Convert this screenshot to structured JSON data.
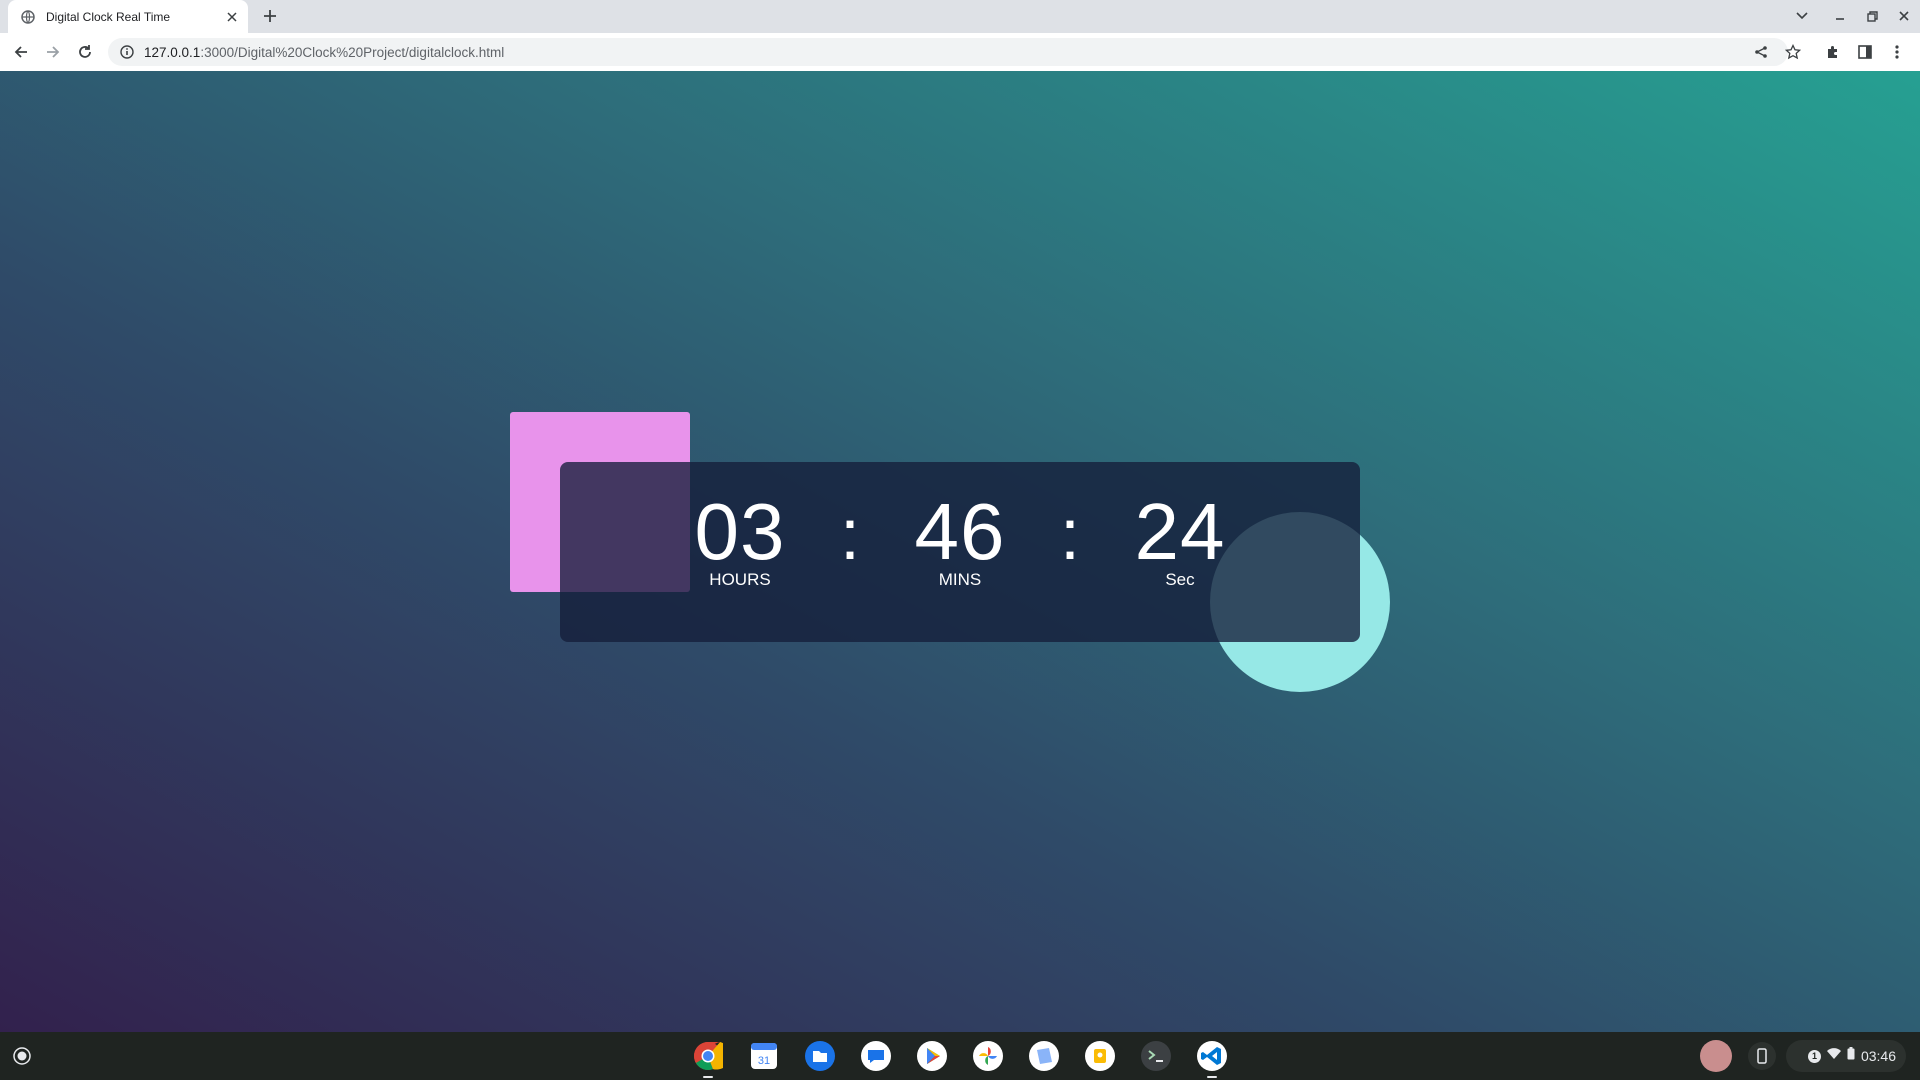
{
  "browser": {
    "tab_title": "Digital Clock Real Time",
    "url_host": "127.0.0.1",
    "url_rest": ":3000/Digital%20Clock%20Project/digitalclock.html"
  },
  "clock": {
    "hours": "03",
    "minutes": "46",
    "seconds": "24",
    "hours_label": "HOURS",
    "minutes_label": "MINS",
    "seconds_label": "Sec",
    "separator": ":"
  },
  "colors": {
    "square": "#e893eb",
    "circle": "#96e8e6",
    "card": "#141e3a"
  },
  "shelf": {
    "apps": [
      "chrome-icon",
      "calendar-icon",
      "files-icon",
      "messages-icon",
      "play-store-icon",
      "photos-icon",
      "gallery-icon",
      "keep-icon",
      "terminal-icon",
      "vscode-icon"
    ],
    "calendar_day": "31",
    "notification_count": "1",
    "time": "03:46"
  }
}
